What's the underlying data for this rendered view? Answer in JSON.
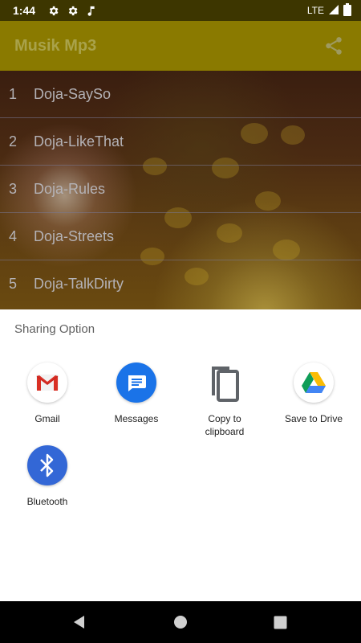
{
  "status_bar": {
    "time": "1:44",
    "network": "LTE",
    "icons": [
      "settings-icon",
      "settings-icon",
      "music-note-icon",
      "signal-icon",
      "battery-icon"
    ]
  },
  "app_bar": {
    "title": "Musik Mp3",
    "share_icon": "share-icon"
  },
  "songs": [
    {
      "number": "1",
      "title": "Doja-SaySo"
    },
    {
      "number": "2",
      "title": "Doja-LikeThat"
    },
    {
      "number": "3",
      "title": "Doja-Rules"
    },
    {
      "number": "4",
      "title": "Doja-Streets"
    },
    {
      "number": "5",
      "title": "Doja-TalkDirty"
    }
  ],
  "share_sheet": {
    "title": "Sharing Option",
    "targets": [
      {
        "label": "Gmail",
        "icon": "gmail-icon"
      },
      {
        "label": "Messages",
        "icon": "messages-icon"
      },
      {
        "label": "Copy to clipboard",
        "icon": "copy-icon"
      },
      {
        "label": "Save to Drive",
        "icon": "drive-icon"
      },
      {
        "label": "Bluetooth",
        "icon": "bluetooth-icon"
      }
    ]
  },
  "nav_bar": {
    "icons": [
      "back-icon",
      "home-icon",
      "recents-icon"
    ]
  },
  "colors": {
    "status_bar": "#3d3600",
    "app_bar": "#8a7a00",
    "title_text": "#a9a24a",
    "messages_blue": "#1a73e8",
    "bluetooth_blue": "#3367d6"
  }
}
